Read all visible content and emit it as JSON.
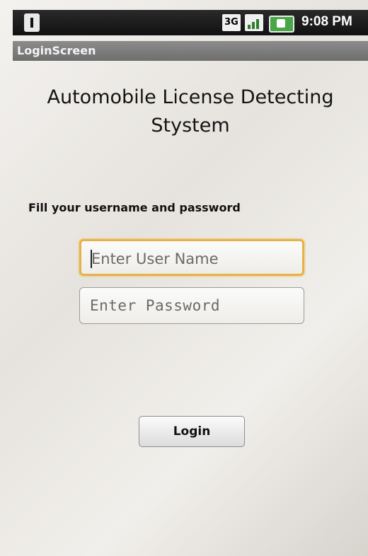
{
  "status_bar": {
    "network_label": "3G",
    "time": "9:08 PM",
    "icons": [
      "sd-card-icon",
      "network-3g-icon",
      "signal-icon",
      "battery-charging-icon"
    ]
  },
  "title_bar": {
    "title": "LoginScreen"
  },
  "main": {
    "app_title": "Automobile License Detecting Stystem",
    "instruction": "Fill your username and password",
    "username_placeholder": "Enter User Name",
    "password_placeholder": "Enter Password",
    "login_label": "Login"
  },
  "colors": {
    "focus_border": "#e6b14a",
    "status_bar_bg": "#111111",
    "title_bar_bg": "#7a7a7a",
    "battery": "#48a548"
  }
}
